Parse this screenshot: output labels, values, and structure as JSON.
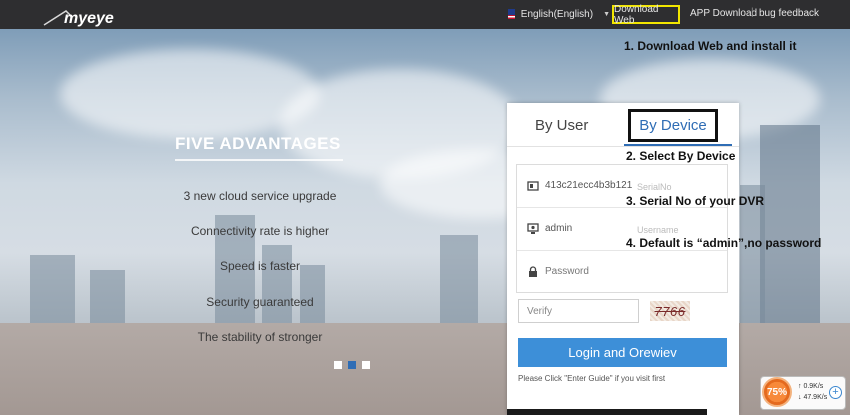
{
  "header": {
    "logo_text": "myeye",
    "language": "English(English)",
    "download_web": "Download Web",
    "app_download": "APP Download",
    "bug_feedback": "bug feedback"
  },
  "advantages": {
    "title": "FIVE ADVANTAGES",
    "items": [
      "3 new cloud service upgrade",
      "Connectivity rate is higher",
      "Speed is faster",
      "Security guaranteed",
      "The stability of stronger"
    ]
  },
  "login": {
    "tab_user": "By User",
    "tab_device": "By Device",
    "serial_value": "413c21ecc4b3b121",
    "serial_ghost": "SerialNo",
    "username_value": "admin",
    "username_ghost": "Username",
    "password_placeholder": "Password",
    "verify_placeholder": "Verify",
    "captcha": "7766",
    "login_button": "Login and Orewiev",
    "guide_text": "Please Click \"Enter Guide\" if you visit first"
  },
  "annotations": {
    "step1": "1. Download Web and install it",
    "step2": "2. Select By Device",
    "step3": "3. Serial No of your DVR",
    "step4": "4. Default is “admin”,no password"
  },
  "widget": {
    "percent": "75%",
    "upload": "0.9K/s",
    "download": "47.9K/s",
    "plus": "+"
  },
  "colors": {
    "topbar": "#2e2e30",
    "accent": "#3d8fd8",
    "highlight_box": "#f2e600"
  }
}
